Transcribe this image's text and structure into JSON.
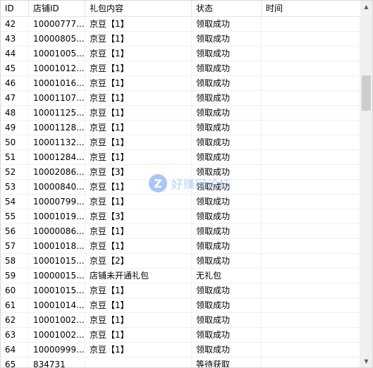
{
  "columns": [
    "ID",
    "店铺ID",
    "礼包内容",
    "状态",
    "时间"
  ],
  "rows": [
    {
      "id": "42",
      "shop": "10000777...",
      "gift": "京豆【1】",
      "status": "领取成功",
      "time": ""
    },
    {
      "id": "43",
      "shop": "10000805...",
      "gift": "京豆【1】",
      "status": "领取成功",
      "time": ""
    },
    {
      "id": "44",
      "shop": "10001005...",
      "gift": "京豆【1】",
      "status": "领取成功",
      "time": ""
    },
    {
      "id": "45",
      "shop": "10001012...",
      "gift": "京豆【1】",
      "status": "领取成功",
      "time": ""
    },
    {
      "id": "46",
      "shop": "10001016...",
      "gift": "京豆【1】",
      "status": "领取成功",
      "time": ""
    },
    {
      "id": "47",
      "shop": "10001107...",
      "gift": "京豆【1】",
      "status": "领取成功",
      "time": ""
    },
    {
      "id": "48",
      "shop": "10001125...",
      "gift": "京豆【1】",
      "status": "领取成功",
      "time": ""
    },
    {
      "id": "49",
      "shop": "10001128...",
      "gift": "京豆【1】",
      "status": "领取成功",
      "time": ""
    },
    {
      "id": "50",
      "shop": "10001132...",
      "gift": "京豆【1】",
      "status": "领取成功",
      "time": ""
    },
    {
      "id": "51",
      "shop": "10001284...",
      "gift": "京豆【1】",
      "status": "领取成功",
      "time": ""
    },
    {
      "id": "52",
      "shop": "10002086...",
      "gift": "京豆【3】",
      "status": "领取成功",
      "time": ""
    },
    {
      "id": "53",
      "shop": "10000840...",
      "gift": "京豆【1】",
      "status": "领取成功",
      "time": ""
    },
    {
      "id": "54",
      "shop": "10000799...",
      "gift": "京豆【1】",
      "status": "领取成功",
      "time": ""
    },
    {
      "id": "55",
      "shop": "10001019...",
      "gift": "京豆【3】",
      "status": "领取成功",
      "time": ""
    },
    {
      "id": "56",
      "shop": "10000086...",
      "gift": "京豆【1】",
      "status": "领取成功",
      "time": ""
    },
    {
      "id": "57",
      "shop": "10001018...",
      "gift": "京豆【1】",
      "status": "领取成功",
      "time": ""
    },
    {
      "id": "58",
      "shop": "10001015...",
      "gift": "京豆【2】",
      "status": "领取成功",
      "time": ""
    },
    {
      "id": "59",
      "shop": "10000015...",
      "gift": "店铺未开通礼包",
      "status": "无礼包",
      "time": ""
    },
    {
      "id": "60",
      "shop": "10001015...",
      "gift": "京豆【1】",
      "status": "领取成功",
      "time": ""
    },
    {
      "id": "61",
      "shop": "10001014...",
      "gift": "京豆【1】",
      "status": "领取成功",
      "time": ""
    },
    {
      "id": "62",
      "shop": "10001002...",
      "gift": "京豆【1】",
      "status": "领取成功",
      "time": ""
    },
    {
      "id": "63",
      "shop": "10001002...",
      "gift": "京豆【1】",
      "status": "领取成功",
      "time": ""
    },
    {
      "id": "64",
      "shop": "10000999...",
      "gift": "京豆【1】",
      "status": "领取成功",
      "time": ""
    },
    {
      "id": "65",
      "shop": "834731",
      "gift": "",
      "status": "等待获取",
      "time": ""
    }
  ],
  "watermark": {
    "logo": "Z",
    "text": "好赚网论坛"
  },
  "scrollbar": {
    "up_icon": "arrow-up-icon",
    "down_icon": "arrow-down-icon",
    "position": 0.2
  }
}
